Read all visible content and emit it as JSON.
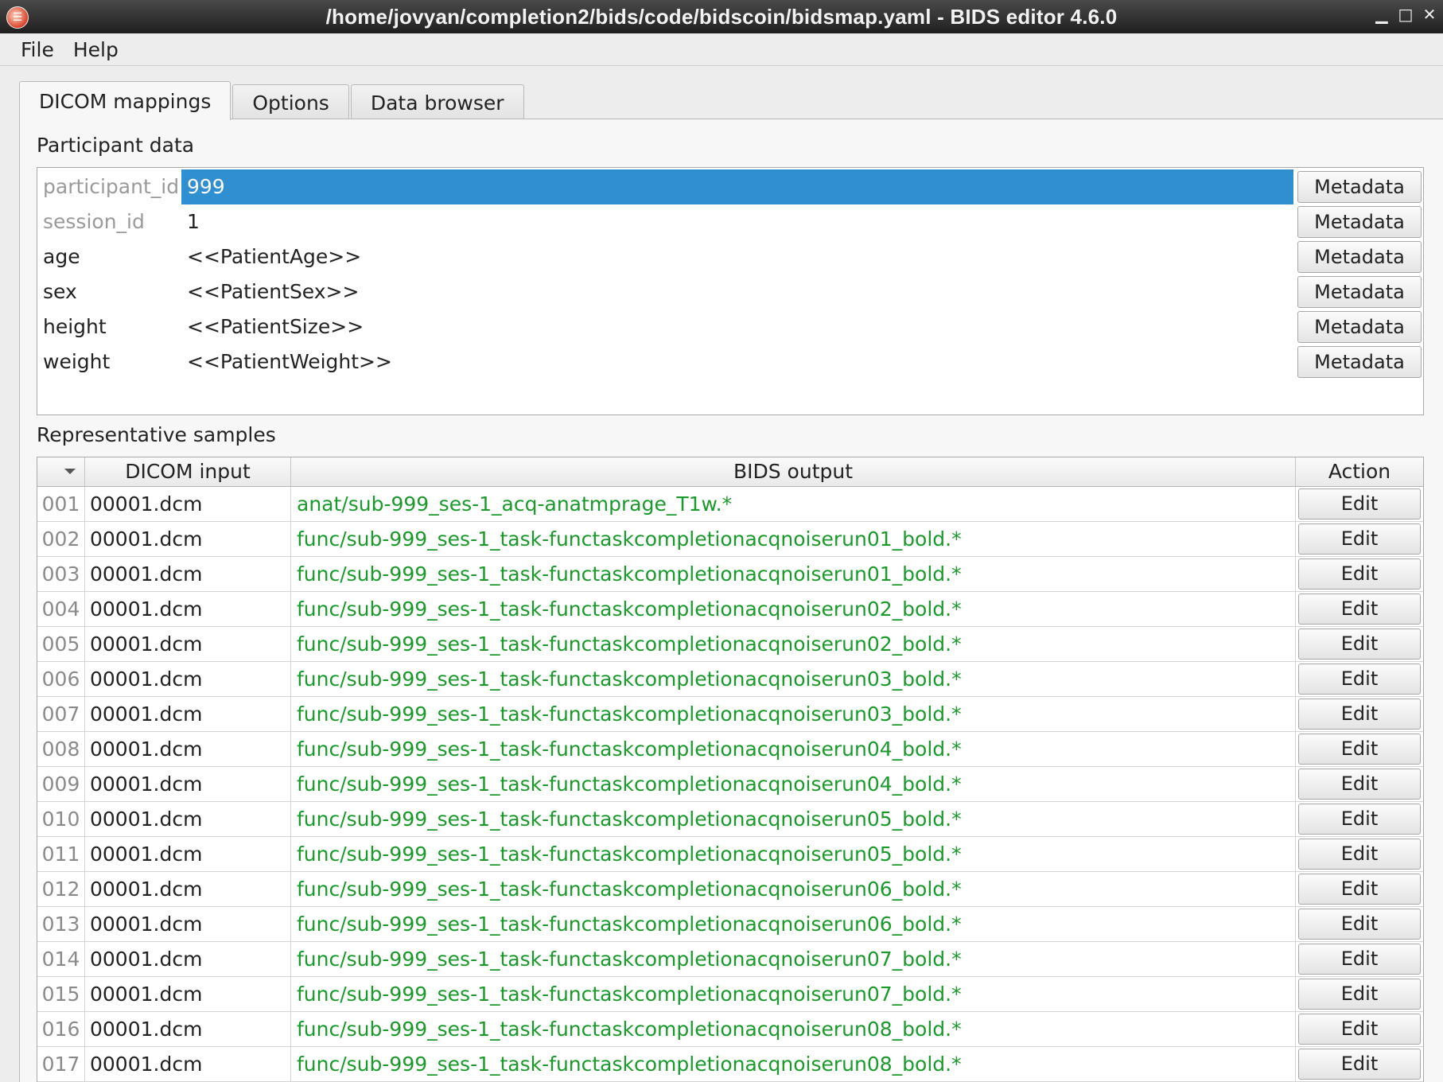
{
  "window": {
    "title": "/home/jovyan/completion2/bids/code/bidscoin/bidsmap.yaml - BIDS editor 4.6.0",
    "buttons": [
      "▁",
      "□",
      "✕"
    ]
  },
  "menu": {
    "items": [
      "File",
      "Help"
    ]
  },
  "tabs": [
    {
      "label": "DICOM mappings",
      "active": true
    },
    {
      "label": "Options",
      "active": false
    },
    {
      "label": "Data browser",
      "active": false
    }
  ],
  "participant": {
    "section_label": "Participant data",
    "button_label": "Metadata",
    "rows": [
      {
        "key": "participant_id",
        "value": "999",
        "muted": true,
        "selected": true
      },
      {
        "key": "session_id",
        "value": "1",
        "muted": true,
        "selected": false
      },
      {
        "key": "age",
        "value": "<<PatientAge>>",
        "muted": false,
        "selected": false
      },
      {
        "key": "sex",
        "value": "<<PatientSex>>",
        "muted": false,
        "selected": false
      },
      {
        "key": "height",
        "value": "<<PatientSize>>",
        "muted": false,
        "selected": false
      },
      {
        "key": "weight",
        "value": "<<PatientWeight>>",
        "muted": false,
        "selected": false
      }
    ]
  },
  "samples": {
    "section_label": "Representative samples",
    "columns": [
      "DICOM input",
      "BIDS output",
      "Action"
    ],
    "button_label": "Edit",
    "rows": [
      {
        "idx": "001",
        "input": "00001.dcm",
        "output": "anat/sub-999_ses-1_acq-anatmprage_T1w.*"
      },
      {
        "idx": "002",
        "input": "00001.dcm",
        "output": "func/sub-999_ses-1_task-functaskcompletionacqnoiserun01_bold.*"
      },
      {
        "idx": "003",
        "input": "00001.dcm",
        "output": "func/sub-999_ses-1_task-functaskcompletionacqnoiserun01_bold.*"
      },
      {
        "idx": "004",
        "input": "00001.dcm",
        "output": "func/sub-999_ses-1_task-functaskcompletionacqnoiserun02_bold.*"
      },
      {
        "idx": "005",
        "input": "00001.dcm",
        "output": "func/sub-999_ses-1_task-functaskcompletionacqnoiserun02_bold.*"
      },
      {
        "idx": "006",
        "input": "00001.dcm",
        "output": "func/sub-999_ses-1_task-functaskcompletionacqnoiserun03_bold.*"
      },
      {
        "idx": "007",
        "input": "00001.dcm",
        "output": "func/sub-999_ses-1_task-functaskcompletionacqnoiserun03_bold.*"
      },
      {
        "idx": "008",
        "input": "00001.dcm",
        "output": "func/sub-999_ses-1_task-functaskcompletionacqnoiserun04_bold.*"
      },
      {
        "idx": "009",
        "input": "00001.dcm",
        "output": "func/sub-999_ses-1_task-functaskcompletionacqnoiserun04_bold.*"
      },
      {
        "idx": "010",
        "input": "00001.dcm",
        "output": "func/sub-999_ses-1_task-functaskcompletionacqnoiserun05_bold.*"
      },
      {
        "idx": "011",
        "input": "00001.dcm",
        "output": "func/sub-999_ses-1_task-functaskcompletionacqnoiserun05_bold.*"
      },
      {
        "idx": "012",
        "input": "00001.dcm",
        "output": "func/sub-999_ses-1_task-functaskcompletionacqnoiserun06_bold.*"
      },
      {
        "idx": "013",
        "input": "00001.dcm",
        "output": "func/sub-999_ses-1_task-functaskcompletionacqnoiserun06_bold.*"
      },
      {
        "idx": "014",
        "input": "00001.dcm",
        "output": "func/sub-999_ses-1_task-functaskcompletionacqnoiserun07_bold.*"
      },
      {
        "idx": "015",
        "input": "00001.dcm",
        "output": "func/sub-999_ses-1_task-functaskcompletionacqnoiserun07_bold.*"
      },
      {
        "idx": "016",
        "input": "00001.dcm",
        "output": "func/sub-999_ses-1_task-functaskcompletionacqnoiserun08_bold.*"
      },
      {
        "idx": "017",
        "input": "00001.dcm",
        "output": "func/sub-999_ses-1_task-functaskcompletionacqnoiserun08_bold.*"
      }
    ]
  },
  "colors": {
    "selection": "#2f8fd0",
    "bids_output_text": "#1a9a2a",
    "muted_key": "#9a9a9a"
  }
}
